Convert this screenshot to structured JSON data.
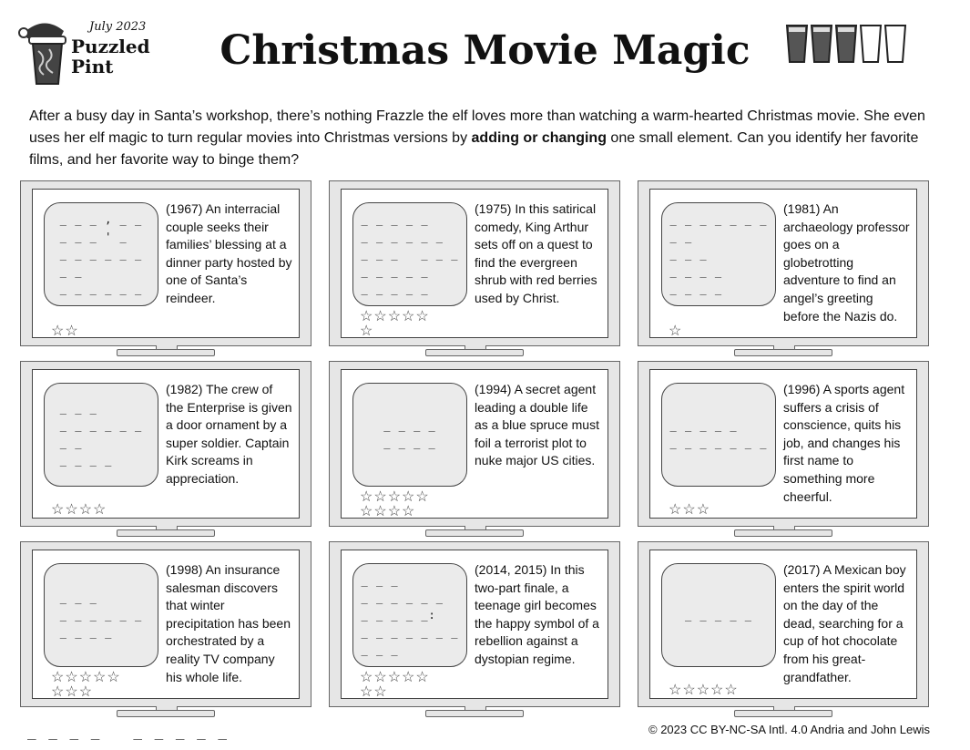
{
  "logo": {
    "date": "July 2023",
    "name": "Puzzled Pint"
  },
  "title": "Christmas Movie Magic",
  "difficulty": {
    "filled": 3,
    "total": 5
  },
  "intro": {
    "before": "After a busy day in Santa’s workshop, there’s nothing Frazzle the elf loves more than watching a warm-hearted Christmas movie. She even uses her elf magic to turn regular movies into Christmas versions by ",
    "bold": "adding or changing",
    "after": " one small element. Can you identify her favorite films, and her favorite way to binge them?"
  },
  "tvs": [
    {
      "blanks": "_ _ _ , _ _\n_ _ _ ' _\n_ _ _ _ _ _\n_ _\n_ _ _ _ _ _",
      "stars": "☆☆",
      "clue": "(1967) An interracial couple seeks their families’ blessing at a dinner party hosted by one of Santa’s reindeer."
    },
    {
      "blanks": "_ _ _ _ _\n_ _ _ _ _ _\n_ _ _   _ _ _\n_ _ _ _ _\n_ _ _ _ _",
      "stars": "☆☆☆☆☆\n☆",
      "clue": "(1975) In this satirical comedy, King Arthur sets off on a quest to find the evergreen shrub with red berries used by Christ."
    },
    {
      "blanks": "_ _ _ _ _ _ _\n_ _\n_ _ _\n_ _ _ _\n_ _ _ _",
      "stars": "☆",
      "clue": "(1981) An archaeology professor goes on a globetrotting adventure to find an angel’s greeting before the Nazis do."
    },
    {
      "blanks": "_ _ _\n_ _ _ _ _ _\n_ _\n_ _ _ _",
      "stars": "☆☆☆☆",
      "clue": "(1982) The crew of the Enterprise is given a door ornament by a super soldier. Captain Kirk screams in appreciation."
    },
    {
      "blanks": "_ _ _ _\n_ _ _ _",
      "stars": "☆☆☆☆☆\n☆☆☆☆",
      "clue": "(1994) A secret agent leading a double life as a blue spruce must foil a terrorist plot to nuke major US cities."
    },
    {
      "blanks": "_ _ _ _ _\n_ _ _ _ _ _ _",
      "stars": "☆☆☆",
      "clue": "(1996) A sports agent suffers a crisis of conscience, quits his job, and changes his first name to something more cheerful."
    },
    {
      "blanks": "_ _ _\n_ _ _ _ _ _\n_ _ _ _",
      "stars": "☆☆☆☆☆\n☆☆☆",
      "clue": "(1998) An insurance salesman discovers that winter precipitation has been orchestrated by a reality TV company his whole life."
    },
    {
      "blanks": "_ _ _\n_ _ _ _ _ _\n_ _ _ _ _:\n_ _ _ _ _ _ _\n_ _ _",
      "stars": "☆☆☆☆☆\n☆☆",
      "clue": "(2014, 2015) In this two-part finale, a teenage girl becomes the happy symbol of a rebellion against a dystopian regime."
    },
    {
      "blanks": "_ _ _ _ _",
      "stars": "☆☆☆☆☆",
      "clue": "(2017) A Mexican boy enters the spirit world on the day of the dead, searching for a cup of hot chocolate from his great-grandfather."
    }
  ],
  "final_answer_blanks": "_ _ _ _   _ _ _ _ _",
  "copyright": "© 2023 CC BY-NC-SA Intl. 4.0 Andria and John Lewis"
}
